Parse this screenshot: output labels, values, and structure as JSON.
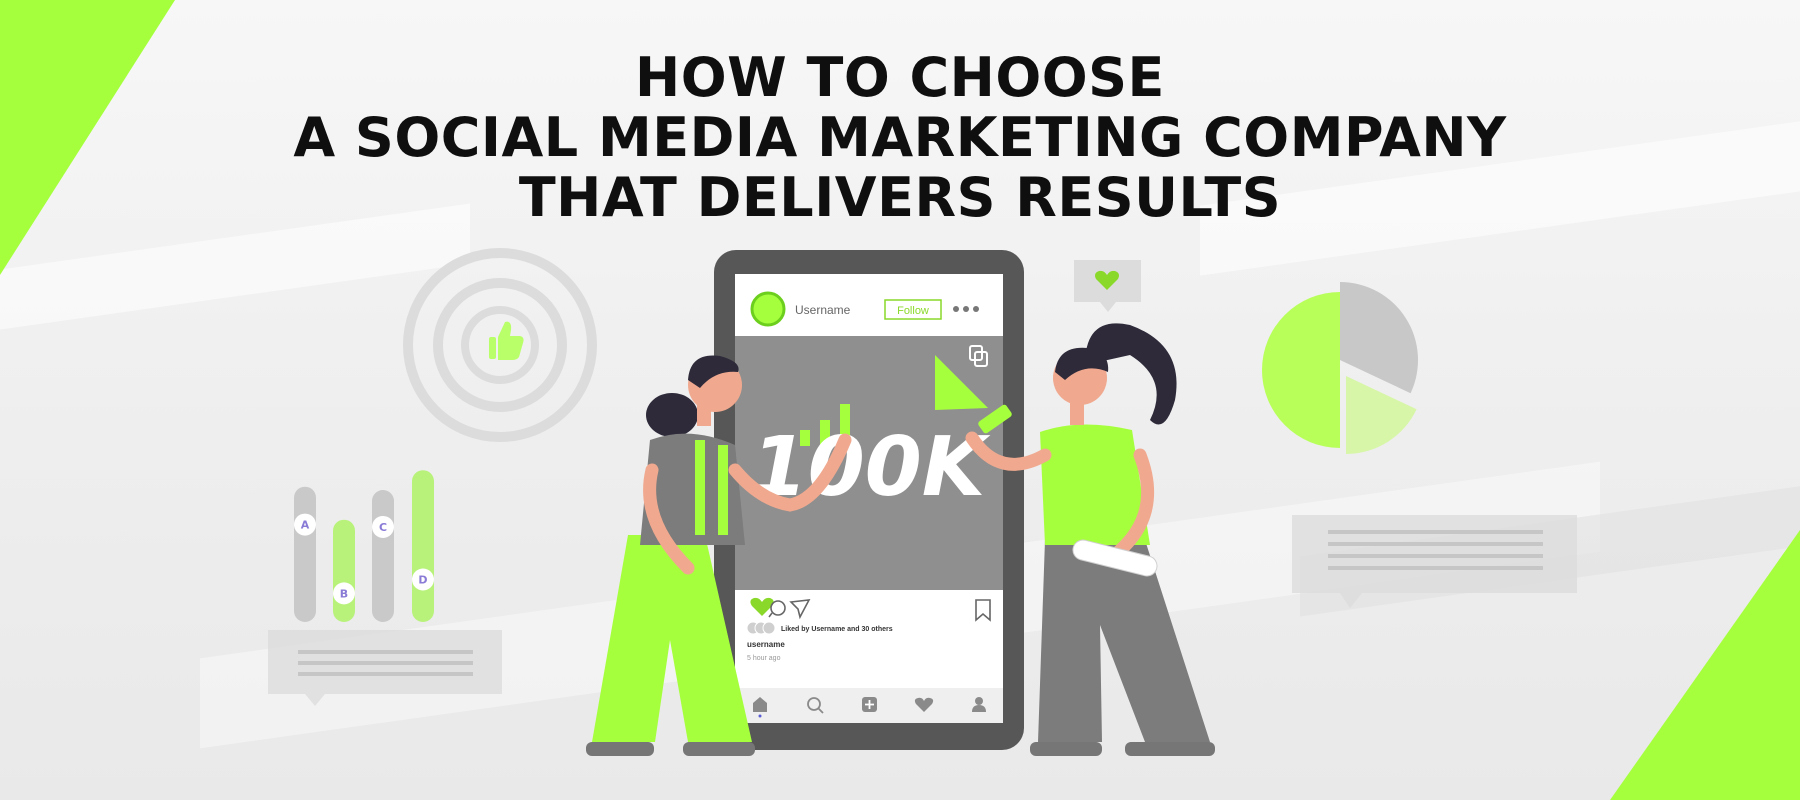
{
  "headline": {
    "line1": "HOW TO CHOOSE",
    "line2": "A SOCIAL MEDIA MARKETING COMPANY",
    "line3": "THAT DELIVERS RESULTS"
  },
  "post": {
    "username": "Username",
    "follow_label": "Follow",
    "big_stat": "100K",
    "liked_by": "Liked by Username and 30 others",
    "caption_user": "username",
    "time_ago": "5 hour ago"
  },
  "bar_labels": [
    "A",
    "B",
    "C",
    "D"
  ],
  "bar_levels": [
    0.82,
    0.62,
    0.8,
    0.92
  ],
  "pie_slices": [
    0.32,
    0.18,
    0.5
  ],
  "colors": {
    "accent": "#a6ff3d",
    "dark": "#2b2b2b",
    "gray": "#8c8c8c",
    "text": "#0f0f0f"
  },
  "icons": [
    "heart-icon",
    "comment-icon",
    "share-icon",
    "bookmark-icon",
    "home-icon",
    "search-icon",
    "add-icon",
    "like-icon",
    "profile-icon",
    "thumbs-up-icon",
    "megaphone-icon",
    "copy-icon",
    "more-icon"
  ]
}
